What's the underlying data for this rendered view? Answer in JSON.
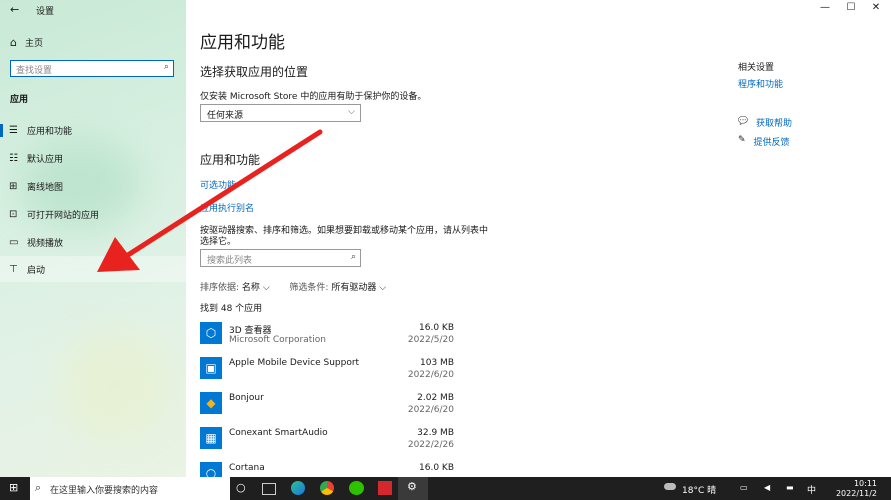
{
  "window": {
    "title": "设置",
    "back_icon": "←",
    "minimize": "—",
    "maximize": "☐",
    "close": "✕"
  },
  "sidebar": {
    "home_icon": "⌂",
    "home_label": "主页",
    "search_placeholder": "查找设置",
    "search_icon": "⌕",
    "section": "应用",
    "items": [
      {
        "icon": "☰",
        "label": "应用和功能"
      },
      {
        "icon": "☷",
        "label": "默认应用"
      },
      {
        "icon": "⊞",
        "label": "离线地图"
      },
      {
        "icon": "⊡",
        "label": "可打开网站的应用"
      },
      {
        "icon": "▭",
        "label": "视频播放"
      },
      {
        "icon": "⊤",
        "label": "启动"
      }
    ]
  },
  "main": {
    "title": "应用和功能",
    "source_heading": "选择获取应用的位置",
    "source_desc": "仅安装 Microsoft Store 中的应用有助于保护你的设备。",
    "source_value": "任何来源",
    "chevron": "⌵",
    "apps_heading": "应用和功能",
    "link_optional": "可选功能",
    "link_alias": "应用执行别名",
    "search_desc_1": "按驱动器搜索、排序和筛选。如果想要卸载或移动某个应用，请从列表中",
    "search_desc_2": "选择它。",
    "list_search_placeholder": "搜索此列表",
    "search_icon": "⌕",
    "sort_label": "排序依据:",
    "sort_value": "名称",
    "filter_label": "筛选条件:",
    "filter_value": "所有驱动器",
    "found": "找到 48 个应用",
    "apps": [
      {
        "icon": "⬡",
        "name": "3D 查看器",
        "publisher": "Microsoft Corporation",
        "size": "16.0 KB",
        "date": "2022/5/20",
        "color": "#0078d4"
      },
      {
        "icon": "▣",
        "name": "Apple Mobile Device Support",
        "publisher": "",
        "size": "103 MB",
        "date": "2022/6/20",
        "color": "#0078d4"
      },
      {
        "icon": "◆",
        "name": "Bonjour",
        "publisher": "",
        "size": "2.02 MB",
        "date": "2022/6/20",
        "color": "#0078d4"
      },
      {
        "icon": "▦",
        "name": "Conexant SmartAudio",
        "publisher": "",
        "size": "32.9 MB",
        "date": "2022/2/26",
        "color": "#0078d4"
      },
      {
        "icon": "○",
        "name": "Cortana",
        "publisher": "",
        "size": "16.0 KB",
        "date": "",
        "color": "#0078d4"
      }
    ]
  },
  "related": {
    "heading": "相关设置",
    "link": "程序和功能",
    "help_icon": "💬",
    "help": "获取帮助",
    "feedback_icon": "✎",
    "feedback": "提供反馈"
  },
  "taskbar": {
    "start_icon": "⊞",
    "search_placeholder": "在这里输入你要搜索的内容",
    "search_icon": "⌕",
    "task_view": "○",
    "weather": "18°C 晴",
    "ime": "中",
    "time": "10:11",
    "date": "2022/11/2"
  },
  "accent": "#0067c0",
  "arrow_color": "#e8231f"
}
